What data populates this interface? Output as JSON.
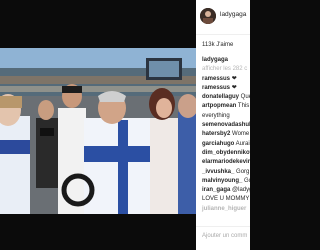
{
  "post": {
    "username": "ladygaga",
    "likes": "113k J'aime",
    "comments": [
      {
        "user": "ladygaga",
        "text": "",
        "muted": false
      },
      {
        "user": "",
        "text": "afficher les 282 c",
        "muted": true
      },
      {
        "user": "ramessus",
        "text": "❤",
        "muted": false
      },
      {
        "user": "ramessus",
        "text": "❤",
        "muted": false
      },
      {
        "user": "donatellaguy",
        "text": "Quel",
        "muted": false
      },
      {
        "user": "artpopmean",
        "text": "This i",
        "muted": false
      },
      {
        "user": "",
        "text": "everything",
        "muted": false
      },
      {
        "user": "semenovadashul",
        "text": "",
        "muted": false
      },
      {
        "user": "hatersby2",
        "text": "Wome",
        "muted": false
      },
      {
        "user": "garciahugo",
        "text": "Aurai",
        "muted": false
      },
      {
        "user": "dim_obydennikov",
        "text": "",
        "muted": false
      },
      {
        "user": "elarmariodekevir",
        "text": "",
        "muted": false
      },
      {
        "user": "_ivvushka_",
        "text": "Gorg",
        "muted": false
      },
      {
        "user": "malvinyoung_",
        "text": "Go",
        "muted": false
      },
      {
        "user": "iran_gaga",
        "text": "@ladyg",
        "muted": false
      },
      {
        "user": "",
        "text": "LOVE U MOMMY",
        "muted": false
      },
      {
        "user": "julianne_higuer",
        "text": "",
        "muted": true
      }
    ],
    "add_comment_placeholder": "Ajouter un comm"
  },
  "colors": {
    "background": "#0b0b0b",
    "panel": "#ffffff",
    "text": "#262626",
    "muted": "#b5b5b5"
  },
  "icons": [
    "avatar",
    "heart-icon"
  ]
}
